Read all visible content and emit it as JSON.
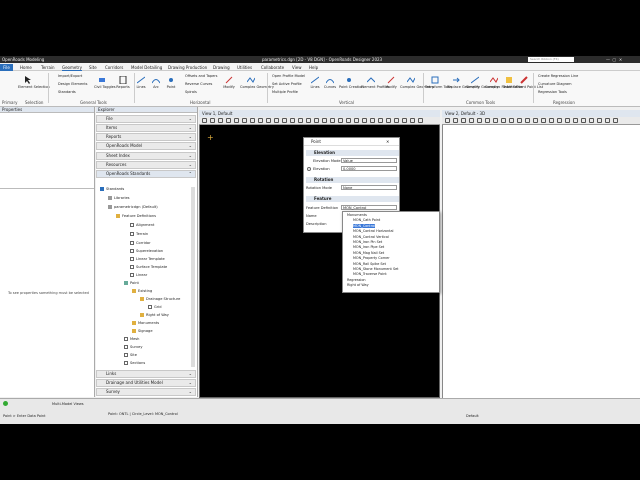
{
  "app": {
    "title": "OpenRoads Modeling",
    "file_title": "parametrics.dgn [2D - V8 DGN] - OpenRoads Designer 2023",
    "search_placeholder": "Search Ribbon (F4)"
  },
  "tabs": [
    "File",
    "Home",
    "Terrain",
    "Geometry",
    "Site",
    "Corridors",
    "Model Detailing",
    "Drawing Production",
    "Drawing",
    "Utilities",
    "Collaborate",
    "View",
    "Help"
  ],
  "ribbon": {
    "buttons": [
      "Element Selection",
      "Civil Toggles",
      "Reports",
      "Lines",
      "Arc",
      "Point",
      "Modify",
      "Complex Geometry",
      "Lines",
      "Curves",
      "Point Creation",
      "Element Profiles",
      "Modify",
      "Complex Geometry",
      "Transform Tools",
      "Replace Geometry",
      "Simplify Geometry",
      "Complex Redefine",
      "Table Editor",
      "Event Point List"
    ],
    "small": [
      "Import/Export",
      "Design Elements",
      "Standards",
      "Offsets and Tapers",
      "Reverse Curves",
      "Spirals",
      "Open Profile Model",
      "Set Active Profile",
      "Multiple Profile",
      "Create Regression Line",
      "Curvature Diagram",
      "Regression Tools"
    ],
    "groups": [
      "Primary",
      "Selection",
      "General Tools",
      "Horizontal",
      "Vertical",
      "Common Tools",
      "Regression"
    ]
  },
  "properties": {
    "title": "Properties",
    "empty_msg": "To see properties something must be selected"
  },
  "explorer": {
    "title": "Explorer",
    "sections": [
      "File",
      "Items",
      "Reports",
      "OpenRoads Model",
      "Sheet Index",
      "Resources",
      "OpenRoads Standards",
      "Links",
      "Drainage and Utilities Model",
      "Survey"
    ],
    "tree": [
      "Standards",
      "Libraries",
      "parametricdgn (Default)",
      "Feature Definitions",
      "Alignment",
      "Terrain",
      "Corridor",
      "Superelevation",
      "Linear Template",
      "Surface Template",
      "Linear",
      "Point",
      "Existing",
      "Drainage Structure",
      "Grid",
      "Right of Way",
      "Monuments",
      "Signage",
      "Mesh",
      "Survey",
      "Site",
      "Sections"
    ]
  },
  "view1": {
    "title": "View 1, Default"
  },
  "view2": {
    "title": "View 2, Default - 3D"
  },
  "dialog": {
    "title": "Point",
    "sec_elevation": "Elevation",
    "elev_mode_label": "Elevation Mode",
    "elev_mode_value": "Value",
    "elevation_label": "Elevation",
    "elevation_value": "0.0000",
    "sec_rotation": "Rotation",
    "rot_mode_label": "Rotation Mode",
    "rot_mode_value": "None",
    "sec_feature": "Feature",
    "featdef_label": "Feature Definition",
    "featdef_value": "MON_Control",
    "name_label": "Name",
    "desc_label": "Description"
  },
  "dropdown": {
    "items": [
      "Monuments",
      "MON_Cath Point",
      "MON_Control",
      "MON_Control Horizontal",
      "MON_Control Vertical",
      "MON_Iron Pin Set",
      "MON_Iron Pipe Set",
      "MON_Mag Nail Set",
      "MON_Property Corner",
      "MON_Rail Spike Set",
      "MON_Stone Monument Set",
      "MON_Traverse Point",
      "Regression",
      "Right of Way"
    ],
    "selected_index": 2
  },
  "status": {
    "prompt": "Point > Enter Data Point",
    "view_mode": "Multi-Model Views",
    "info": "Point: ONTL | Circle_Level: MON_Control",
    "level": "Default"
  }
}
